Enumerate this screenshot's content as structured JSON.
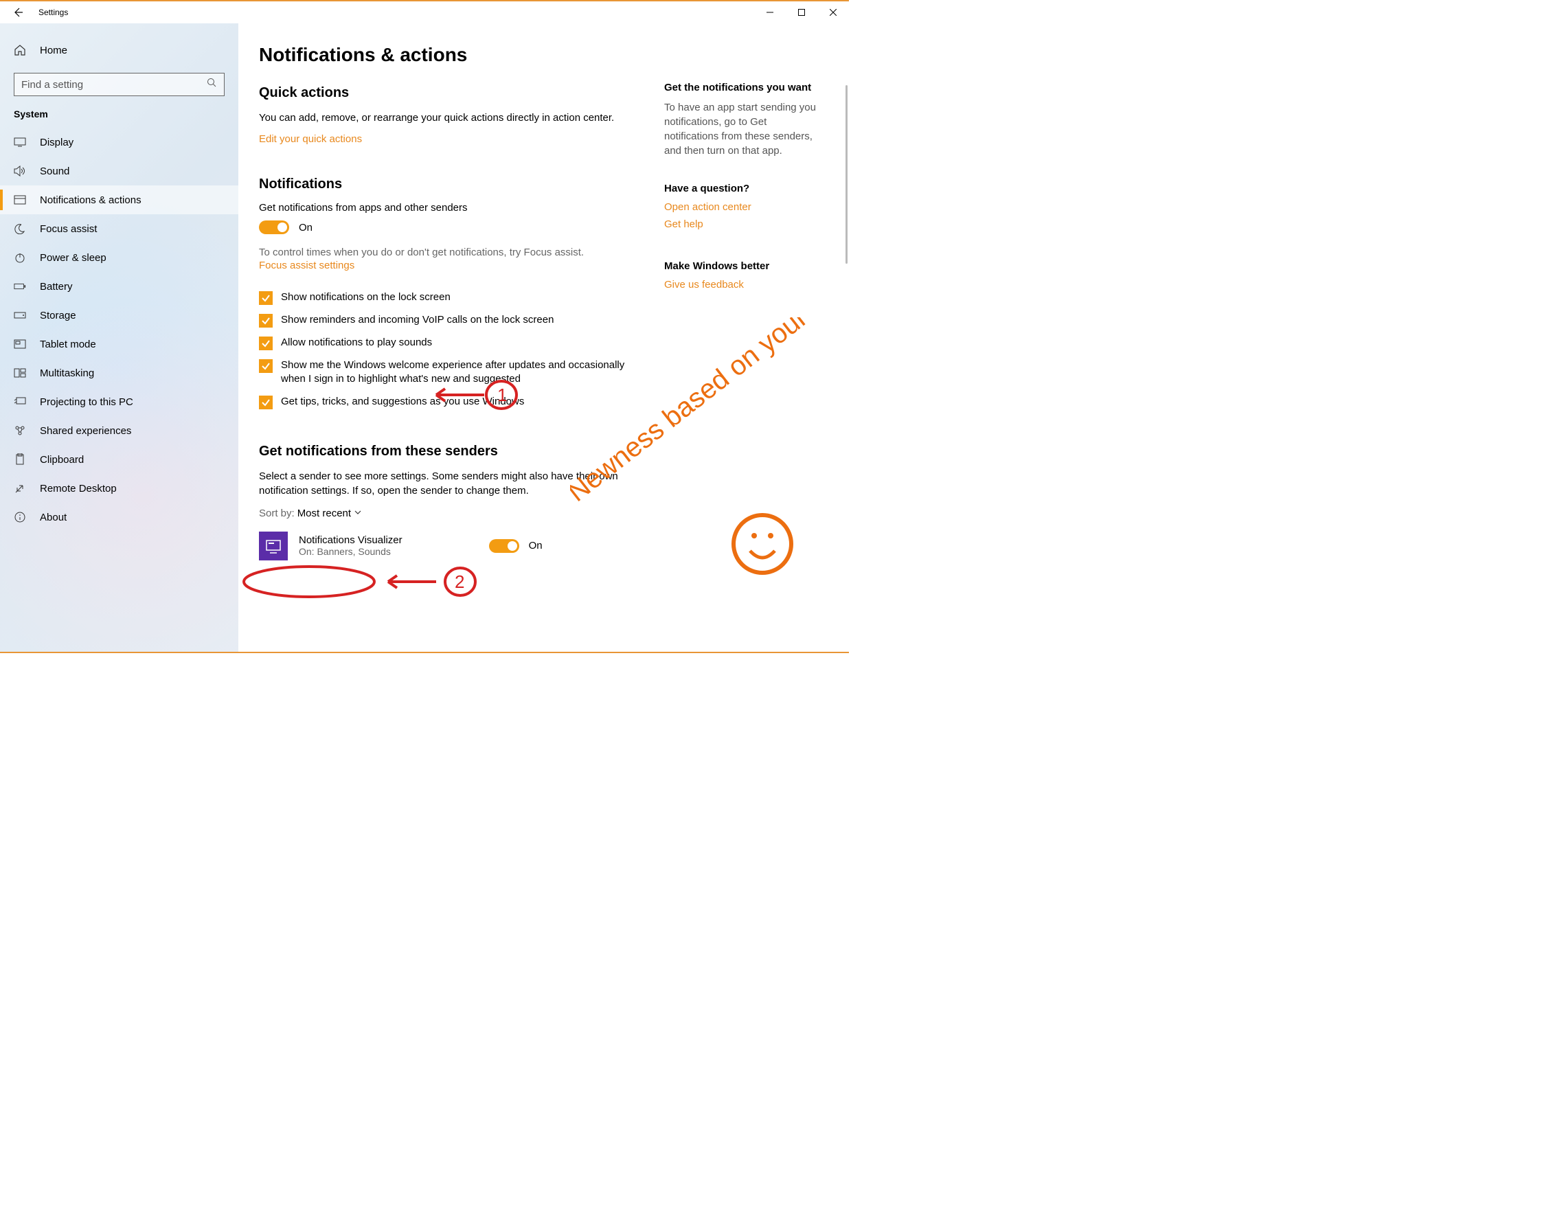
{
  "window": {
    "title": "Settings"
  },
  "sidebar": {
    "home": "Home",
    "search_placeholder": "Find a setting",
    "category": "System",
    "items": [
      {
        "label": "Display"
      },
      {
        "label": "Sound"
      },
      {
        "label": "Notifications & actions"
      },
      {
        "label": "Focus assist"
      },
      {
        "label": "Power & sleep"
      },
      {
        "label": "Battery"
      },
      {
        "label": "Storage"
      },
      {
        "label": "Tablet mode"
      },
      {
        "label": "Multitasking"
      },
      {
        "label": "Projecting to this PC"
      },
      {
        "label": "Shared experiences"
      },
      {
        "label": "Clipboard"
      },
      {
        "label": "Remote Desktop"
      },
      {
        "label": "About"
      }
    ]
  },
  "page": {
    "title": "Notifications & actions",
    "quick_actions": {
      "heading": "Quick actions",
      "desc": "You can add, remove, or rearrange your quick actions directly in action center.",
      "link": "Edit your quick actions"
    },
    "notifications": {
      "heading": "Notifications",
      "toggle_label": "Get notifications from apps and other senders",
      "toggle_state": "On",
      "focus_text": "To control times when you do or don't get notifications, try Focus assist.",
      "focus_link": "Focus assist settings",
      "checkboxes": [
        "Show notifications on the lock screen",
        "Show reminders and incoming VoIP calls on the lock screen",
        "Allow notifications to play sounds",
        "Show me the Windows welcome experience after updates and occasionally when I sign in to highlight what's new and suggested",
        "Get tips, tricks, and suggestions as you use Windows"
      ]
    },
    "senders": {
      "heading": "Get notifications from these senders",
      "desc": "Select a sender to see more settings. Some senders might also have their own notification settings. If so, open the sender to change them.",
      "sort_label": "Sort by:",
      "sort_value": "Most recent",
      "list": [
        {
          "name": "Notifications Visualizer",
          "detail": "On: Banners, Sounds",
          "state": "On"
        }
      ]
    }
  },
  "aside": {
    "want": {
      "title": "Get the notifications you want",
      "text": "To have an app start sending you notifications, go to Get notifications from these senders, and then turn on that app."
    },
    "question": {
      "title": "Have a question?",
      "link1": "Open action center",
      "link2": "Get help"
    },
    "feedback": {
      "title": "Make Windows better",
      "link": "Give us feedback"
    }
  },
  "annotations": {
    "marker1": "1",
    "marker2": "2",
    "handwriting": "Newness based on your feedback"
  }
}
